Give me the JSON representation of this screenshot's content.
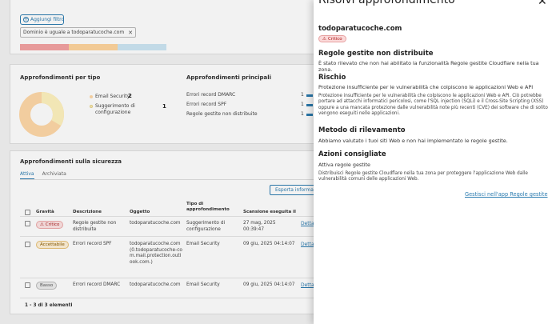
{
  "filters": {
    "add_filter_label": "Aggiungi filtro",
    "active_filter": "Dominio è uguale a todoparatucoche.com"
  },
  "severity_bar": {
    "segments": [
      {
        "color": "#f4a3a3",
        "share": 0.33
      },
      {
        "color": "#ffd59e",
        "share": 0.33
      },
      {
        "color": "#cde6f4",
        "share": 0.34
      }
    ]
  },
  "by_type": {
    "title": "Approfondimenti per tipo",
    "items": [
      {
        "label": "Email Security",
        "value": "2",
        "color": "#ffd9a8"
      },
      {
        "label": "Suggerimento di configurazione",
        "value": "1",
        "color": "#fff3bf"
      }
    ]
  },
  "main_insights": {
    "title": "Approfondimenti principali",
    "items": [
      {
        "label": "Errori record DMARC",
        "value": "1"
      },
      {
        "label": "Errori record SPF",
        "value": "1"
      },
      {
        "label": "Regole gestite non distribuite",
        "value": "1"
      }
    ]
  },
  "security": {
    "title": "Approfondimenti sulla sicurezza",
    "tabs": [
      "Attiva",
      "Archiviata"
    ],
    "export_label": "Esporta informazioni",
    "columns": [
      "Gravità",
      "Descrizione",
      "Oggetto",
      "Tipo di approfondimento",
      "Scansione eseguita il"
    ],
    "rows": [
      {
        "severity": "Critico",
        "description": "Regole gestite non distribuite",
        "object": "todoparatucoche.com",
        "type": "Suggerimento di configurazione",
        "scanned": "27 mag, 2025 00:39:47",
        "action": "Detta"
      },
      {
        "severity": "Accettabile",
        "description": "Errori record SPF",
        "object": "todoparatucoche.com (0.todoparatucoche-com.mail.protection.outlook.com.)",
        "type": "Email Security",
        "scanned": "09 giu, 2025 04:14:07",
        "action": "Detta"
      },
      {
        "severity": "Basso",
        "description": "Errori record DMARC",
        "object": "todoparatucoche.com",
        "type": "Email Security",
        "scanned": "09 giu, 2025 04:14:07",
        "action": "Detta"
      }
    ],
    "pagination": "1 - 3 di 3 elementi"
  },
  "panel": {
    "title": "Risolvi approfondimento",
    "domain": "todoparatucoche.com",
    "badge": "Critico",
    "sections": {
      "h1": "Regole gestite non distribuite",
      "t1": "È stato rilevato che non hai abilitato la funzionalità Regole gestite Cloudflare nella tua zona.",
      "h2": "Rischio",
      "t2": "Protezione insufficiente per le vulnerabilità che colpiscono le applicazioni Web e API",
      "t2b": "Protezione insufficiente per le vulnerabilità che colpiscono le applicazioni Web e API. Ciò potrebbe portare ad attacchi informatici pericolosi, come l'SQL injection (SQLi) e il Cross-Site Scripting (XSS) oppure a una mancata protezione dalle vulnerabilità note più recenti (CVE) dei software che di solito vengono eseguiti nelle applicazioni.",
      "h3": "Metodo di rilevamento",
      "t3": "Abbiamo valutato i tuoi siti Web e non hai implementato le regole gestite.",
      "h4": "Azioni consigliate",
      "t4": "Attiva regole gestite",
      "t4b": "Distribuisci Regole gestite Cloudflare nella tua zona per proteggere l'applicazione Web dalle vulnerabilità comuni delle applicazioni Web.",
      "link": "Gestisci nell'app Regole gestite"
    }
  }
}
